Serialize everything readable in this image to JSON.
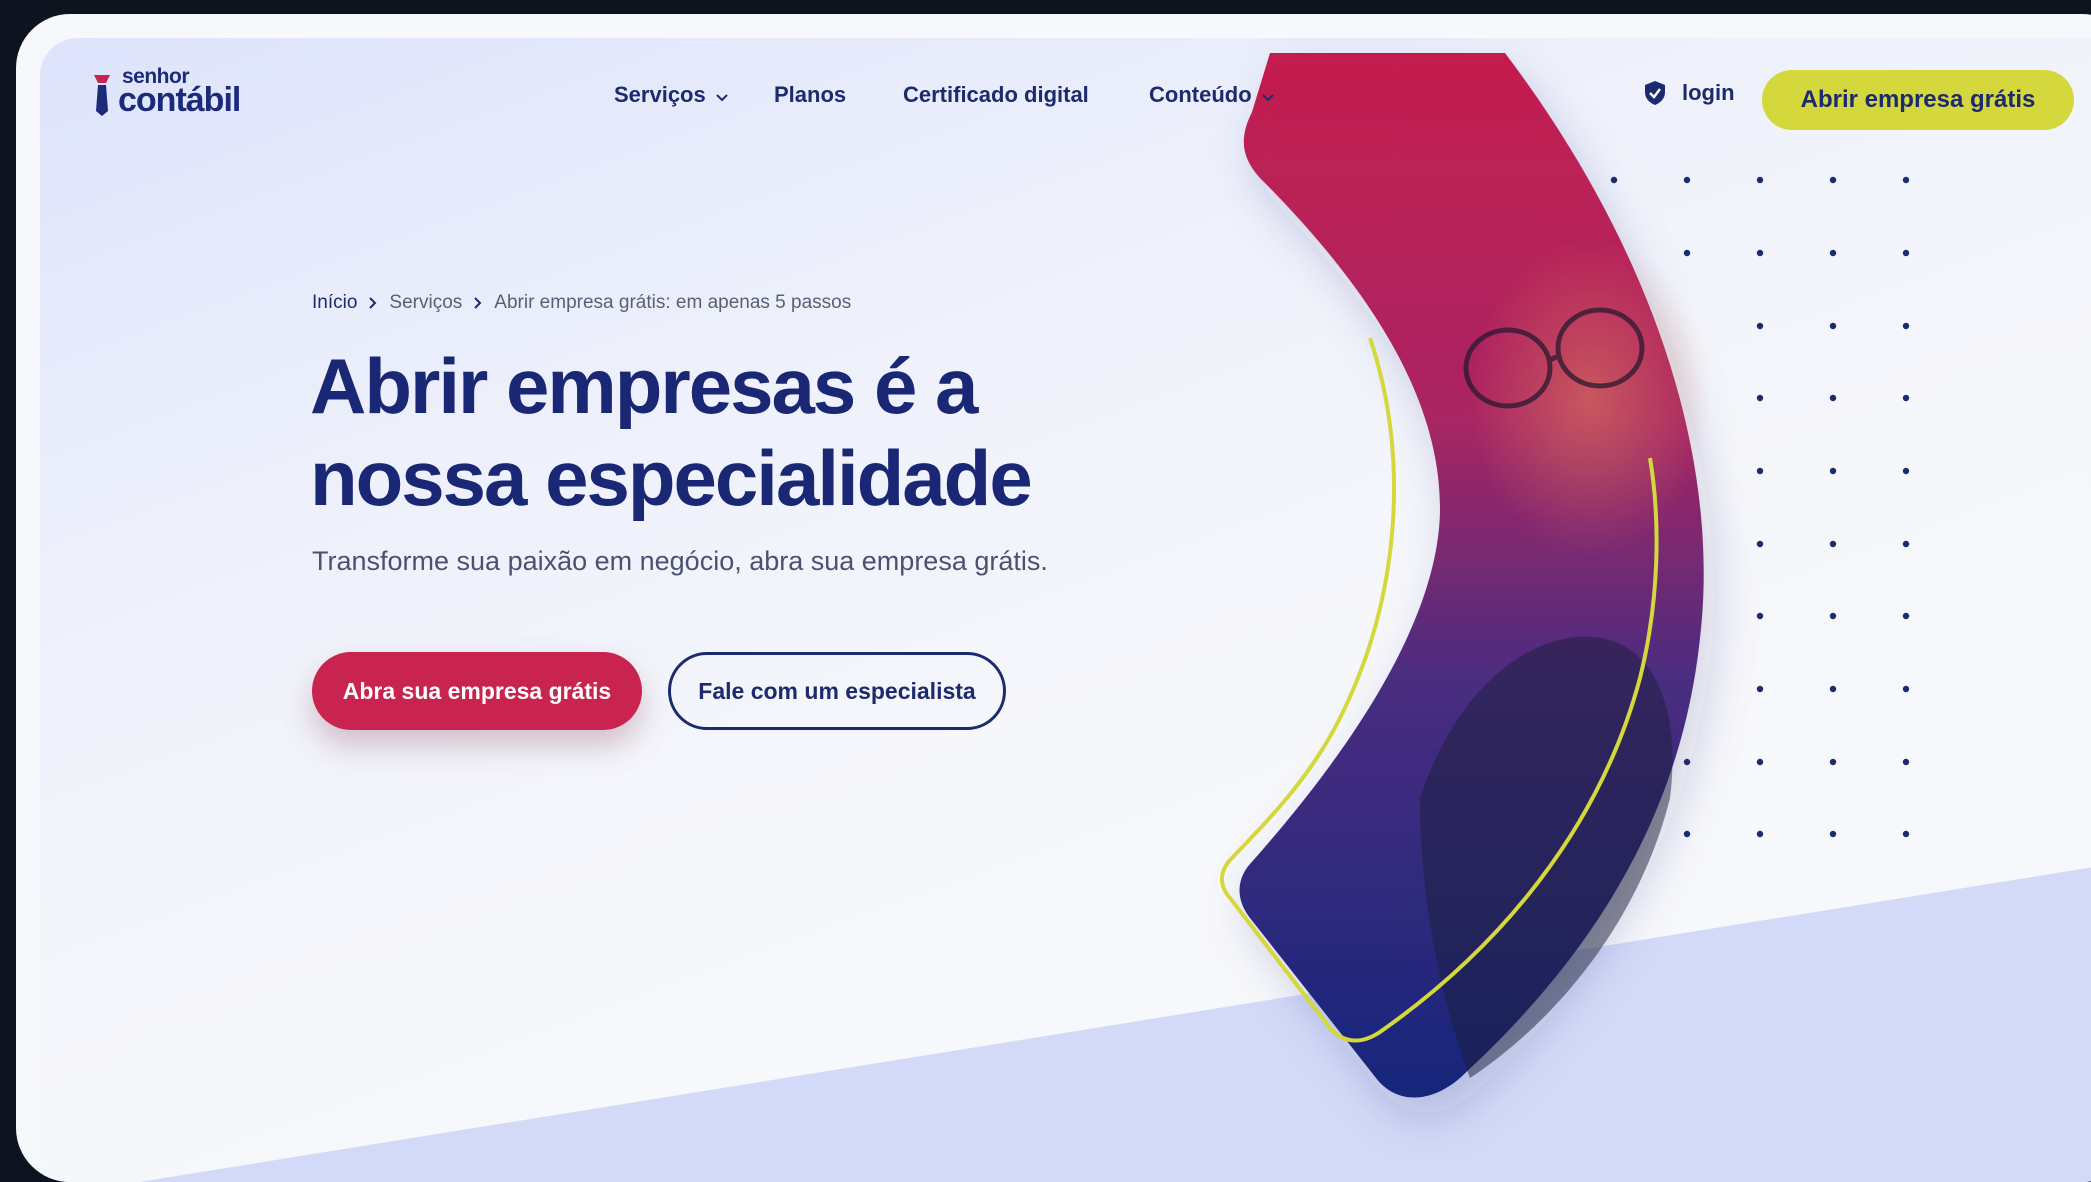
{
  "brand": {
    "logo_small": "senhor",
    "logo_big": "contábil",
    "colors": {
      "navy": "#1c2a6e",
      "crimson": "#c8244f",
      "lime": "#d5d83c"
    }
  },
  "nav": {
    "items": [
      {
        "label": "Serviços",
        "has_dropdown": true,
        "icon": "chevron-down-icon"
      },
      {
        "label": "Planos",
        "has_dropdown": false
      },
      {
        "label": "Certificado digital",
        "has_dropdown": false
      },
      {
        "label": "Conteúdo",
        "has_dropdown": true,
        "icon": "chevron-down-icon"
      }
    ],
    "login_label": "login",
    "login_icon": "shield-icon",
    "cta_label": "Abrir empresa grátis"
  },
  "breadcrumb": {
    "items": [
      "Início",
      "Serviços",
      "Abrir empresa grátis: em apenas 5 passos"
    ]
  },
  "hero": {
    "title_line1": "Abrir empresas é a",
    "title_line2": "nossa especialidade",
    "subtitle": "Transforme sua paixão em negócio, abra sua empresa grátis.",
    "primary_button": "Abra sua empresa grátis",
    "secondary_button": "Fale com um especialista"
  }
}
